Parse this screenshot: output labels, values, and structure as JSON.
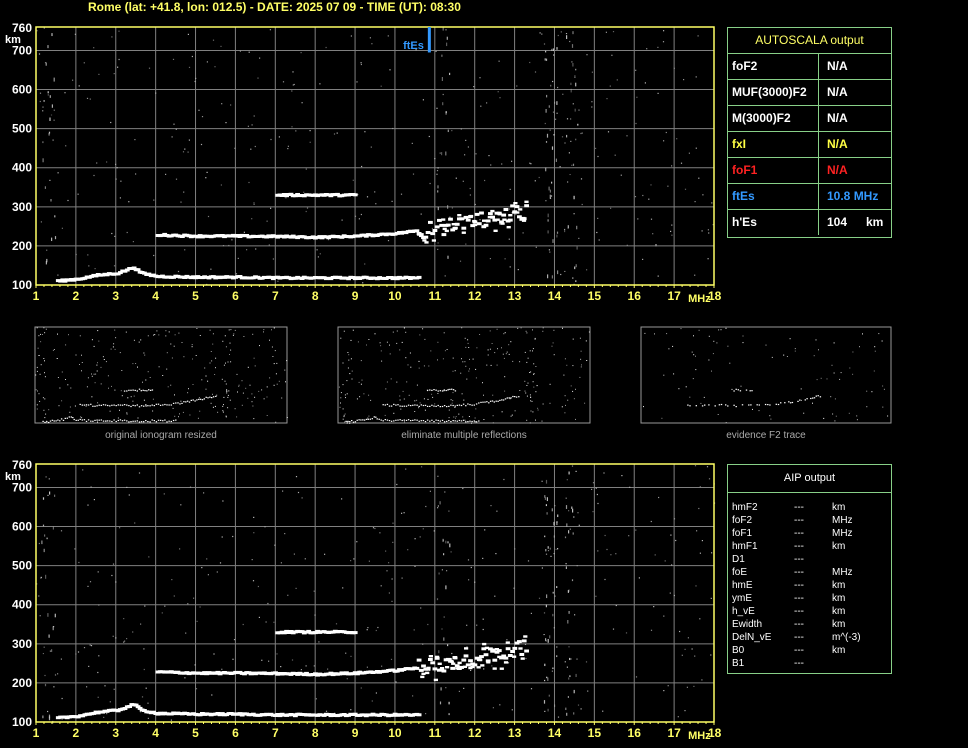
{
  "header": {
    "text": "Rome (lat: +41.8, lon: 012.5) - DATE: 2025 07 09 - TIME (UT): 08:30"
  },
  "chart_data": [
    {
      "type": "scatter",
      "title": "",
      "xlabel": "MHz",
      "ylabel": "km",
      "xlim": [
        1,
        18
      ],
      "ylim": [
        100,
        760
      ],
      "x_ticks": [
        "1",
        "2",
        "3",
        "4",
        "5",
        "6",
        "7",
        "8",
        "9",
        "10",
        "11",
        "12",
        "13",
        "14",
        "15",
        "16",
        "17",
        "18"
      ],
      "y_ticks": [
        "100",
        "200",
        "300",
        "400",
        "500",
        "600",
        "700",
        "760"
      ],
      "grid": true,
      "annotation": {
        "label": "ftEs",
        "x": 10.8
      },
      "series": [
        {
          "values": [
            [
              1.5,
              110
            ],
            [
              2,
              115
            ],
            [
              2.5,
              125
            ],
            [
              3,
              130
            ],
            [
              3.4,
              145
            ],
            [
              3.6,
              130
            ],
            [
              4,
              122
            ],
            [
              5,
              120
            ],
            [
              6,
              120
            ],
            [
              7,
              118
            ],
            [
              8,
              118
            ],
            [
              9,
              118
            ],
            [
              10,
              118
            ],
            [
              10.6,
              118
            ]
          ]
        },
        {
          "values": [
            [
              4,
              228
            ],
            [
              5,
              225
            ],
            [
              6,
              225
            ],
            [
              7,
              224
            ],
            [
              8,
              222
            ],
            [
              9,
              225
            ],
            [
              10,
              232
            ],
            [
              10.6,
              240
            ],
            [
              11,
              245
            ],
            [
              11.5,
              255
            ],
            [
              12,
              265
            ],
            [
              12.5,
              275
            ],
            [
              13,
              285
            ],
            [
              13.3,
              290
            ]
          ]
        },
        {
          "values": [
            [
              7,
              330
            ],
            [
              8,
              330
            ],
            [
              8.5,
              330
            ],
            [
              9,
              330
            ]
          ]
        }
      ]
    },
    {
      "type": "scatter",
      "title": "",
      "xlabel": "MHz",
      "ylabel": "km",
      "xlim": [
        1,
        18
      ],
      "ylim": [
        100,
        760
      ],
      "x_ticks": [
        "1",
        "2",
        "3",
        "4",
        "5",
        "6",
        "7",
        "8",
        "9",
        "10",
        "11",
        "12",
        "13",
        "14",
        "15",
        "16",
        "17",
        "18"
      ],
      "y_ticks": [
        "100",
        "200",
        "300",
        "400",
        "500",
        "600",
        "700",
        "760"
      ],
      "grid": true,
      "series": [
        {
          "values": [
            [
              1.5,
              110
            ],
            [
              2,
              115
            ],
            [
              2.5,
              125
            ],
            [
              3,
              130
            ],
            [
              3.4,
              145
            ],
            [
              3.6,
              130
            ],
            [
              4,
              122
            ],
            [
              5,
              120
            ],
            [
              6,
              120
            ],
            [
              7,
              118
            ],
            [
              8,
              118
            ],
            [
              9,
              118
            ],
            [
              10,
              118
            ],
            [
              10.6,
              118
            ]
          ]
        },
        {
          "values": [
            [
              4,
              228
            ],
            [
              5,
              225
            ],
            [
              6,
              225
            ],
            [
              7,
              224
            ],
            [
              8,
              222
            ],
            [
              9,
              225
            ],
            [
              10,
              232
            ],
            [
              10.6,
              240
            ],
            [
              11,
              245
            ],
            [
              11.5,
              255
            ],
            [
              12,
              265
            ],
            [
              12.5,
              275
            ],
            [
              13,
              285
            ],
            [
              13.3,
              290
            ]
          ]
        },
        {
          "values": [
            [
              7,
              330
            ],
            [
              8,
              330
            ],
            [
              8.5,
              330
            ],
            [
              9,
              330
            ]
          ]
        }
      ]
    }
  ],
  "thumbnails": [
    {
      "caption": "original ionogram resized"
    },
    {
      "caption": "eliminate multiple reflections"
    },
    {
      "caption": "evidence F2 trace"
    }
  ],
  "autoscala": {
    "title": "AUTOSCALA output",
    "rows": [
      {
        "label": "foF2",
        "value": "N/A",
        "unit": "",
        "color": "#ffffff"
      },
      {
        "label": "MUF(3000)F2",
        "value": "N/A",
        "unit": "",
        "color": "#ffffff"
      },
      {
        "label": "M(3000)F2",
        "value": "N/A",
        "unit": "",
        "color": "#ffffff"
      },
      {
        "label": "fxI",
        "value": "N/A",
        "unit": "",
        "color": "#ffff44"
      },
      {
        "label": "foF1",
        "value": "N/A",
        "unit": "",
        "color": "#ff2222"
      },
      {
        "label": "ftEs",
        "value": "10.8 MHz",
        "unit": "",
        "color": "#3399ff"
      },
      {
        "label": "h'Es",
        "value": "104",
        "unit": "km",
        "color": "#ffffff"
      }
    ]
  },
  "aip": {
    "title": "AIP output",
    "rows": [
      {
        "label": "hmF2",
        "value": "---",
        "unit": "km"
      },
      {
        "label": "foF2",
        "value": "---",
        "unit": "MHz"
      },
      {
        "label": "foF1",
        "value": "---",
        "unit": "MHz"
      },
      {
        "label": "hmF1",
        "value": "---",
        "unit": "km"
      },
      {
        "label": "D1",
        "value": "---",
        "unit": ""
      },
      {
        "label": "foE",
        "value": "---",
        "unit": "MHz"
      },
      {
        "label": "hmE",
        "value": "---",
        "unit": "km"
      },
      {
        "label": "ymE",
        "value": "---",
        "unit": "km"
      },
      {
        "label": "h_vE",
        "value": "---",
        "unit": "km"
      },
      {
        "label": "Ewidth",
        "value": "---",
        "unit": "km"
      },
      {
        "label": "DelN_vE",
        "value": "---",
        "unit": "m^(-3)"
      },
      {
        "label": "B0",
        "value": "---",
        "unit": "km"
      },
      {
        "label": "B1",
        "value": "---",
        "unit": ""
      }
    ]
  },
  "colors": {
    "grid": "#808080",
    "axis": "#ffff66",
    "border": "#88d088",
    "trace": "#ffffff",
    "ftes": "#3399ff"
  }
}
